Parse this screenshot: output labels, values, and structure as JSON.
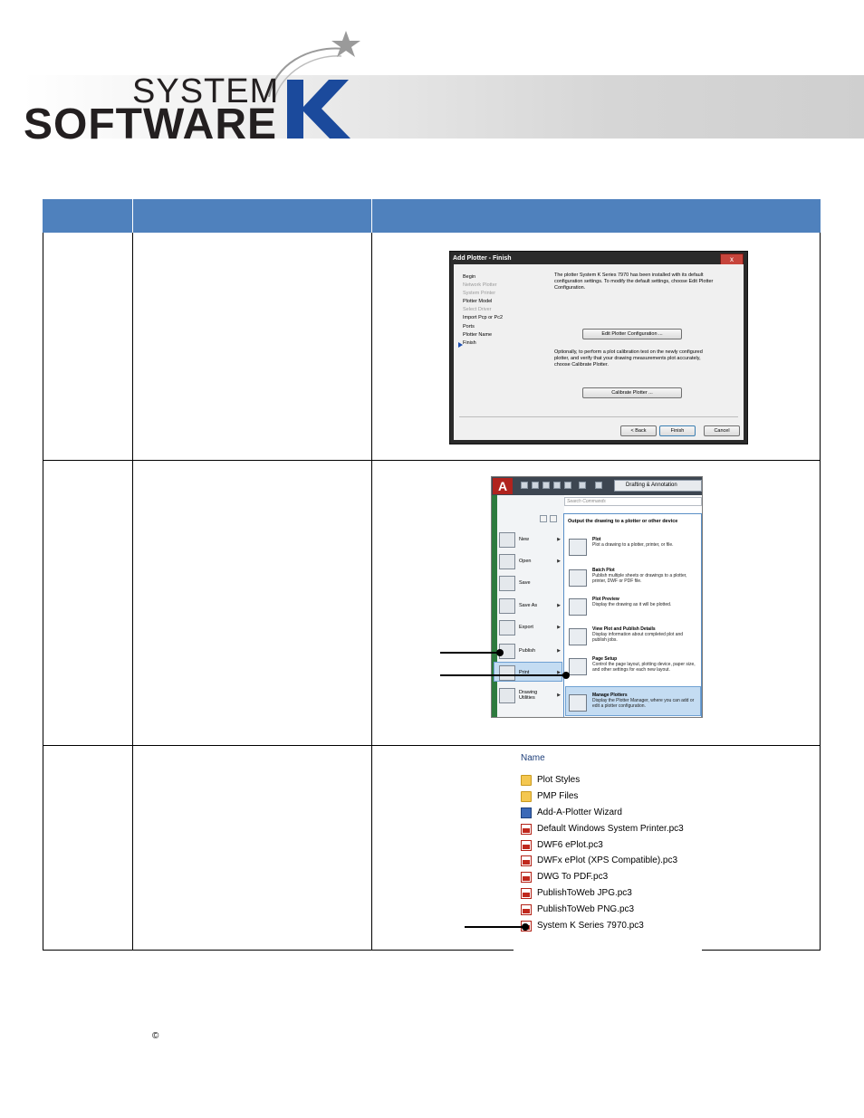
{
  "logo": {
    "line1": "SYSTEM",
    "line2": "SOFTWARE",
    "mark": "K",
    "colors": {
      "k_blue": "#1b4a9c",
      "text": "#231f20",
      "banner": "#d6d6d6"
    },
    "star_icon": "star-icon"
  },
  "table": {
    "header_color": "#4f81bd",
    "headers": [
      "",
      "",
      ""
    ]
  },
  "dialog": {
    "title": "Add Plotter - Finish",
    "close_label": "x",
    "steps": [
      {
        "label": "Begin",
        "enabled": true
      },
      {
        "label": "Network Plotter",
        "enabled": false
      },
      {
        "label": "System Printer",
        "enabled": false
      },
      {
        "label": "Plotter Model",
        "enabled": true
      },
      {
        "label": "Select Driver",
        "enabled": false
      },
      {
        "label": "Import Pcp or Pc2",
        "enabled": true
      },
      {
        "label": "Ports",
        "enabled": true
      },
      {
        "label": "Plotter Name",
        "enabled": true
      },
      {
        "label": "Finish",
        "enabled": true
      }
    ],
    "text1": "The plotter System K Series 7970 has been installed with its default configuration settings.  To modify the default settings, choose Edit Plotter Configuration.",
    "edit_button": "Edit Plotter Configuration ...",
    "text2": "Optionally, to perform a plot calibration test on the newly configured plotter, and verify that your drawing measurements plot accurately, choose Calibrate Plotter.",
    "calibrate_button": "Calibrate Plotter ...",
    "back_button": "< Back",
    "finish_button": "Finish",
    "cancel_button": "Cancel"
  },
  "menu": {
    "app_button": "A",
    "workspace": "Drafting & Annotation",
    "search_placeholder": "Search Commands",
    "items": [
      {
        "label": "New",
        "icon": "new-file-icon",
        "has_arrow": true
      },
      {
        "label": "Open",
        "icon": "open-folder-icon",
        "has_arrow": true
      },
      {
        "label": "Save",
        "icon": "save-icon",
        "has_arrow": false
      },
      {
        "label": "Save As",
        "icon": "save-as-icon",
        "has_arrow": true
      },
      {
        "label": "Export",
        "icon": "export-icon",
        "has_arrow": true
      },
      {
        "label": "Publish",
        "icon": "publish-icon",
        "has_arrow": true
      },
      {
        "label": "Print",
        "icon": "print-icon",
        "has_arrow": true
      },
      {
        "label": "Drawing Utilities",
        "icon": "utilities-icon",
        "has_arrow": true
      }
    ],
    "submenu_title": "Output the drawing to a plotter or other device",
    "subitems": [
      {
        "title": "Plot",
        "desc": "Plot a drawing to a plotter, printer, or file.",
        "icon": "plot-icon"
      },
      {
        "title": "Batch Plot",
        "desc": "Publish multiple sheets or drawings to a plotter, printer, DWF or PDF file.",
        "icon": "batch-plot-icon"
      },
      {
        "title": "Plot Preview",
        "desc": "Display the drawing as it will be plotted.",
        "icon": "plot-preview-icon"
      },
      {
        "title": "View Plot and Publish Details",
        "desc": "Display information about completed plot and publish jobs.",
        "icon": "plot-details-icon"
      },
      {
        "title": "Page Setup",
        "desc": "Control the page layout, plotting device, paper size, and other settings for each new layout.",
        "icon": "page-setup-icon"
      },
      {
        "title": "Manage Plotters",
        "desc": "Display the Plotter Manager, where you can add or edit a plotter configuration.",
        "icon": "manage-plotters-icon"
      }
    ],
    "highlight_color": "#c4dcf2"
  },
  "filelist": {
    "column_header": "Name",
    "files": [
      {
        "name": "Plot Styles",
        "type": "folder"
      },
      {
        "name": "PMP Files",
        "type": "folder"
      },
      {
        "name": "Add-A-Plotter Wizard",
        "type": "wizard"
      },
      {
        "name": "Default Windows System Printer.pc3",
        "type": "pc3"
      },
      {
        "name": "DWF6 ePlot.pc3",
        "type": "pc3"
      },
      {
        "name": "DWFx ePlot (XPS Compatible).pc3",
        "type": "pc3"
      },
      {
        "name": "DWG To PDF.pc3",
        "type": "pc3"
      },
      {
        "name": "PublishToWeb JPG.pc3",
        "type": "pc3"
      },
      {
        "name": "PublishToWeb PNG.pc3",
        "type": "pc3"
      },
      {
        "name": "System K Series 7970.pc3",
        "type": "pc3"
      }
    ]
  },
  "footer": {
    "copyright": "©"
  }
}
